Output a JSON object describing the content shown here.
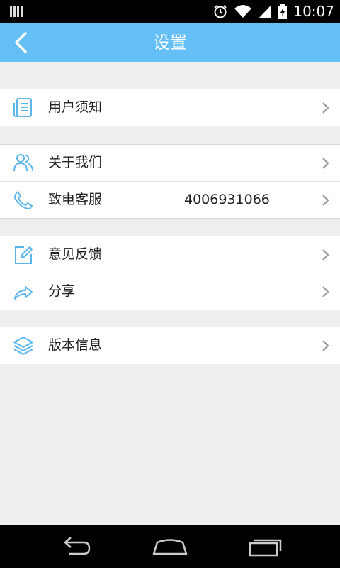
{
  "status_bar": {
    "time": "10:07"
  },
  "app_bar": {
    "title": "设置"
  },
  "settings": {
    "group1": [
      {
        "label": "用户须知"
      }
    ],
    "group2": [
      {
        "label": "关于我们"
      },
      {
        "label": "致电客服",
        "value": "4006931066"
      }
    ],
    "group3": [
      {
        "label": "意见反馈"
      },
      {
        "label": "分享"
      }
    ],
    "group4": [
      {
        "label": "版本信息"
      }
    ]
  },
  "colors": {
    "accent": "#63bff6",
    "icon": "#5bb6ee",
    "background": "#eeeeee"
  }
}
